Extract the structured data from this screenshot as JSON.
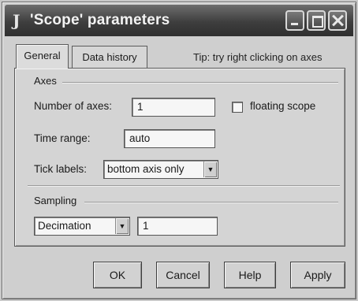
{
  "window": {
    "title": "'Scope' parameters",
    "app_icon": "matlab-icon"
  },
  "tabs": [
    {
      "label": "General",
      "selected": true
    },
    {
      "label": "Data history",
      "selected": false
    }
  ],
  "tip": "Tip: try right clicking on axes",
  "axes": {
    "group_label": "Axes",
    "number_of_axes_label": "Number of axes:",
    "number_of_axes_value": "1",
    "floating_scope_label": "floating scope",
    "floating_scope_checked": false,
    "time_range_label": "Time range:",
    "time_range_value": "auto",
    "tick_labels_label": "Tick labels:",
    "tick_labels_value": "bottom axis only"
  },
  "sampling": {
    "group_label": "Sampling",
    "mode_value": "Decimation",
    "decimation_value": "1"
  },
  "buttons": {
    "ok": "OK",
    "cancel": "Cancel",
    "help": "Help",
    "apply": "Apply"
  }
}
